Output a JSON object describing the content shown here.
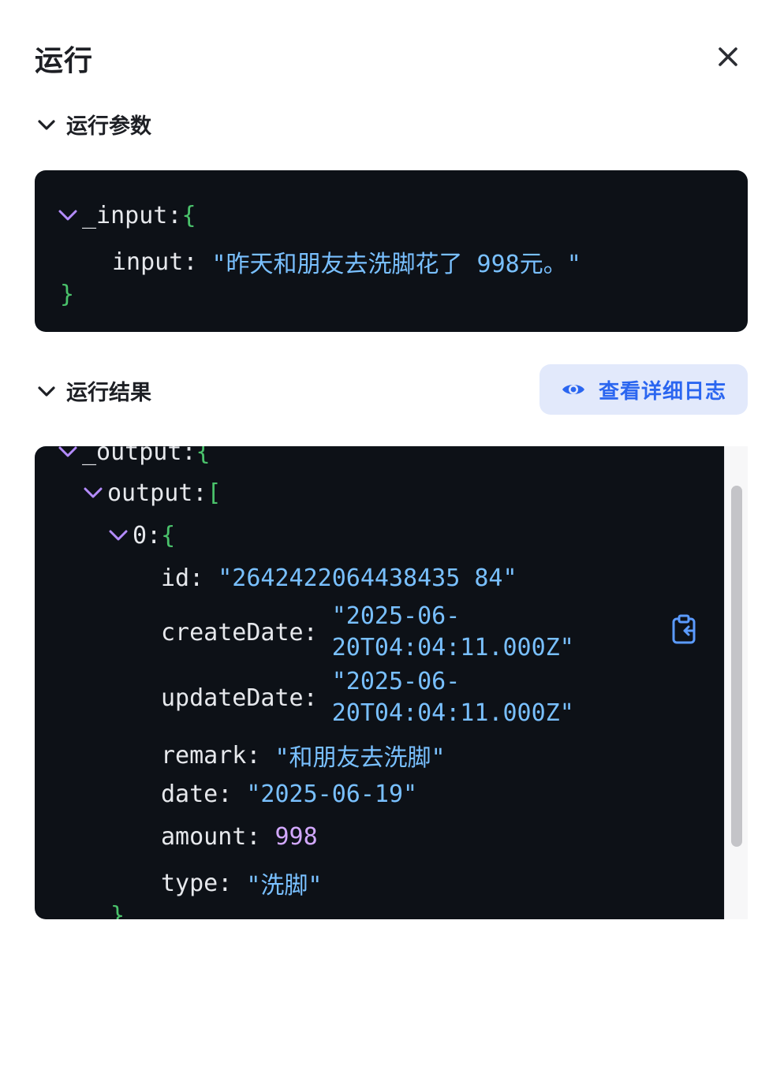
{
  "header": {
    "title": "运行"
  },
  "params_section": {
    "label": "运行参数",
    "root_key": "_input",
    "open_brace": "{",
    "close_brace": "}",
    "fields": [
      {
        "key": "input",
        "value": "\"昨天和朋友去洗脚花了 998元。\""
      }
    ]
  },
  "result_section": {
    "label": "运行结果",
    "view_log_label": "查看详细日志",
    "root_key": "_output",
    "root_brace": "{",
    "array_key": "output",
    "array_bracket": "[",
    "index_key": "0",
    "index_brace": "{",
    "close_brace": "}",
    "fields": {
      "id": {
        "key": "id",
        "value": "\"2642422064438435 84\""
      },
      "createDate": {
        "key": "createDate",
        "value_line1": "\"2025-06-",
        "value_line2": "20T04:04:11.000Z\""
      },
      "updateDate": {
        "key": "updateDate",
        "value_line1": "\"2025-06-",
        "value_line2": "20T04:04:11.000Z\""
      },
      "remark": {
        "key": "remark",
        "value": "\"和朋友去洗脚\""
      },
      "date": {
        "key": "date",
        "value": "\"2025-06-19\""
      },
      "amount": {
        "key": "amount",
        "value": "998"
      },
      "type": {
        "key": "type",
        "value": "\"洗脚\""
      }
    }
  },
  "icons": {
    "close": "close-icon",
    "chevron": "chevron-down-icon",
    "eye": "eye-icon",
    "copy": "clipboard-copy-icon"
  },
  "colors": {
    "code_bg": "#0d1117",
    "brace": "#4ac26b",
    "string": "#79c0ff",
    "number": "#d2a8ff",
    "toggle": "#b48cff",
    "accent": "#2b66f0",
    "button_bg": "#e2e9fb"
  }
}
